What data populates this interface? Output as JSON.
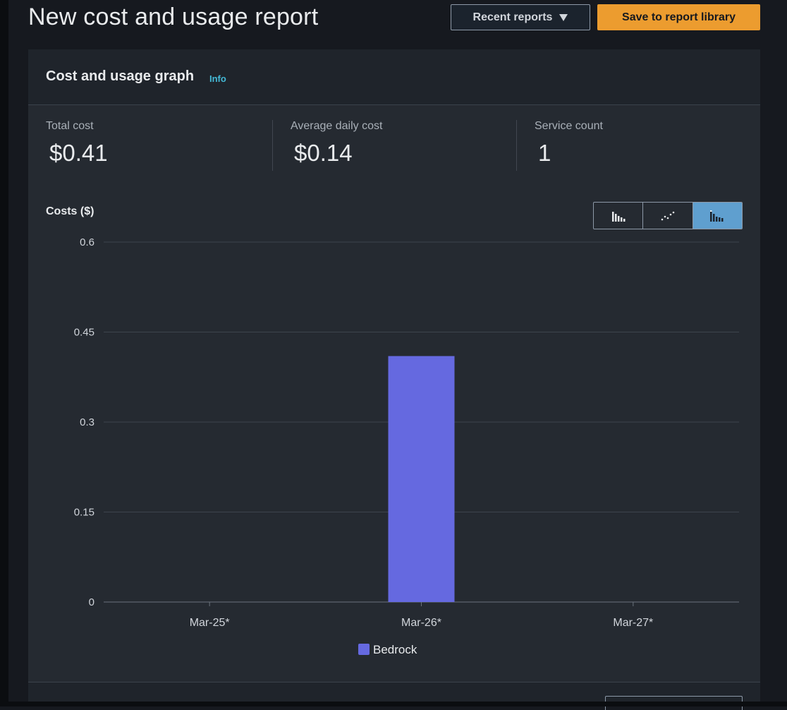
{
  "header": {
    "title": "New cost and usage report",
    "recent_reports_label": "Recent reports",
    "save_label": "Save to report library"
  },
  "panel": {
    "title": "Cost and usage graph",
    "info_label": "Info",
    "metrics": [
      {
        "label": "Total cost",
        "value": "$0.41"
      },
      {
        "label": "Average daily cost",
        "value": "$0.14"
      },
      {
        "label": "Service count",
        "value": "1"
      }
    ],
    "chart_types": [
      "bar-chart-icon",
      "line-chart-icon",
      "stacked-bar-chart-icon"
    ],
    "active_chart_type": "stacked-bar-chart-icon"
  },
  "chart_data": {
    "type": "bar",
    "ylabel": "Costs ($)",
    "categories": [
      "Mar-25*",
      "Mar-26*",
      "Mar-27*"
    ],
    "series": [
      {
        "name": "Bedrock",
        "color": "#6569e0",
        "values": [
          0,
          0.41,
          0
        ]
      }
    ],
    "ylim": [
      0,
      0.6
    ],
    "yticks": [
      0,
      0.15,
      0.3,
      0.45,
      0.6
    ],
    "ytick_labels": [
      "0",
      "0.15",
      "0.3",
      "0.45",
      "0.6"
    ],
    "grid": true,
    "legend": "bottom-center"
  }
}
